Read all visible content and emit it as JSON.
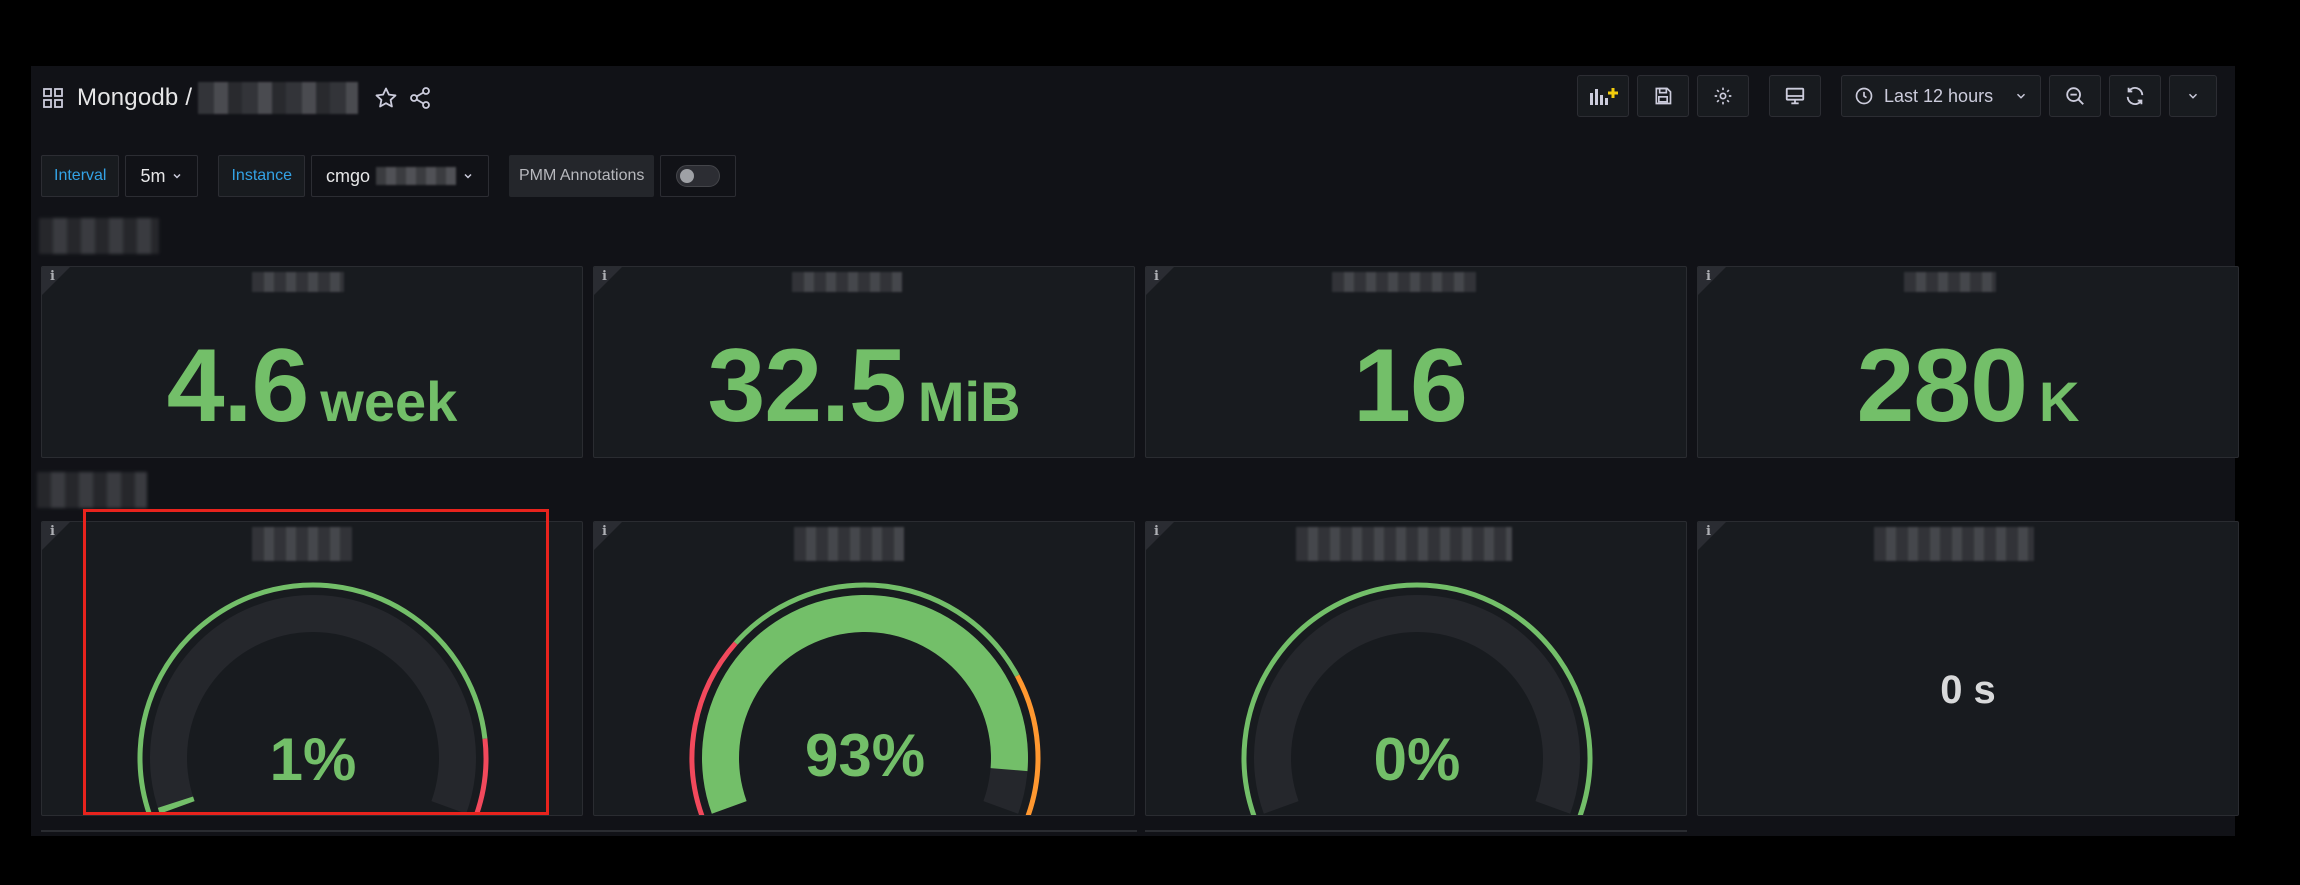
{
  "header": {
    "title": "Mongodb /",
    "toolbar": {
      "time_range": "Last 12 hours"
    }
  },
  "variables": {
    "interval_label": "Interval",
    "interval_value": "5m",
    "instance_label": "Instance",
    "instance_value": "cmgo",
    "annotations_label": "PMM Annotations",
    "annotations_enabled": false
  },
  "stat_panels": [
    {
      "value": "4.6",
      "unit": "week"
    },
    {
      "value": "32.5",
      "unit": "MiB"
    },
    {
      "value": "16",
      "unit": ""
    },
    {
      "value": "280",
      "unit": "K"
    }
  ],
  "gauge_panels": [
    {
      "display": "1%",
      "percent": 1,
      "thresholds": "green→red at ~90%"
    },
    {
      "display": "93%",
      "percent": 93,
      "thresholds": "red-green-orange"
    },
    {
      "display": "0%",
      "percent": 0,
      "thresholds": "green"
    }
  ],
  "duration_panel": {
    "value": "0 s"
  },
  "colors": {
    "green": "#73BF69",
    "red": "#F2495C",
    "orange": "#FF9830",
    "accent_blue": "#33A2E5",
    "highlight": "#E8231D"
  }
}
